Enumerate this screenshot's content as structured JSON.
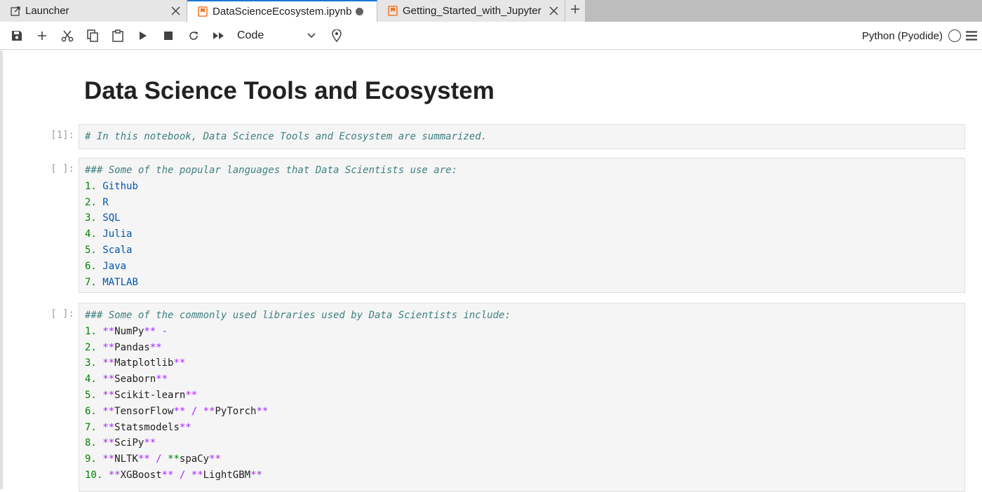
{
  "tabs": [
    {
      "label": "Launcher",
      "icon": "external-link-icon",
      "active": false,
      "closable": true
    },
    {
      "label": "DataScienceEcosystem.ipynb",
      "icon": "notebook-icon",
      "active": true,
      "dirty": true
    },
    {
      "label": "Getting_Started_with_Jupyter",
      "icon": "notebook-icon",
      "active": false,
      "closable": true
    }
  ],
  "toolbar": {
    "cell_type": "Code",
    "kernel_name": "Python (Pyodide)"
  },
  "notebook": {
    "heading": "Data Science Tools and Ecosystem",
    "cells": [
      {
        "prompt": "[1]:",
        "comment": "# In this notebook, Data Science Tools and Ecosystem are summarized."
      },
      {
        "prompt": "[ ]:",
        "comment": "### Some of the popular languages that Data Scientists use are:",
        "items": [
          {
            "num": "1.",
            "text": "Github"
          },
          {
            "num": "2.",
            "text": "R"
          },
          {
            "num": "3.",
            "text": "SQL"
          },
          {
            "num": "4.",
            "text": "Julia"
          },
          {
            "num": "5.",
            "text": "Scala"
          },
          {
            "num": "6.",
            "text": "Java"
          },
          {
            "num": "7.",
            "text": "MATLAB"
          }
        ]
      },
      {
        "prompt": "[ ]:",
        "comment": "### Some of the commonly used libraries used by Data Scientists include:",
        "items": [
          {
            "num": "1.",
            "a": "NumPy",
            "suffix": " -"
          },
          {
            "num": "2.",
            "a": "Pandas"
          },
          {
            "num": "3.",
            "a": "Matplotlib"
          },
          {
            "num": "4.",
            "a": "Seaborn"
          },
          {
            "num": "5.",
            "a": "Scikit-learn"
          },
          {
            "num": "6.",
            "a": "TensorFlow",
            "b": "PyTorch"
          },
          {
            "num": "7.",
            "a": "Statsmodels"
          },
          {
            "num": "8.",
            "a": "SciPy"
          },
          {
            "num": "9.",
            "a": "NLTK",
            "b": "spaCy"
          },
          {
            "num": "10.",
            "a": "XGBoost",
            "b": "LightGBM"
          }
        ]
      }
    ]
  },
  "colors": {
    "accent": "#1976d2",
    "notebook_tab_icon": "#f37626",
    "comment": "#408080",
    "number": "#008000",
    "variable": "#0055aa",
    "bold_marker": "#aa22ff"
  }
}
